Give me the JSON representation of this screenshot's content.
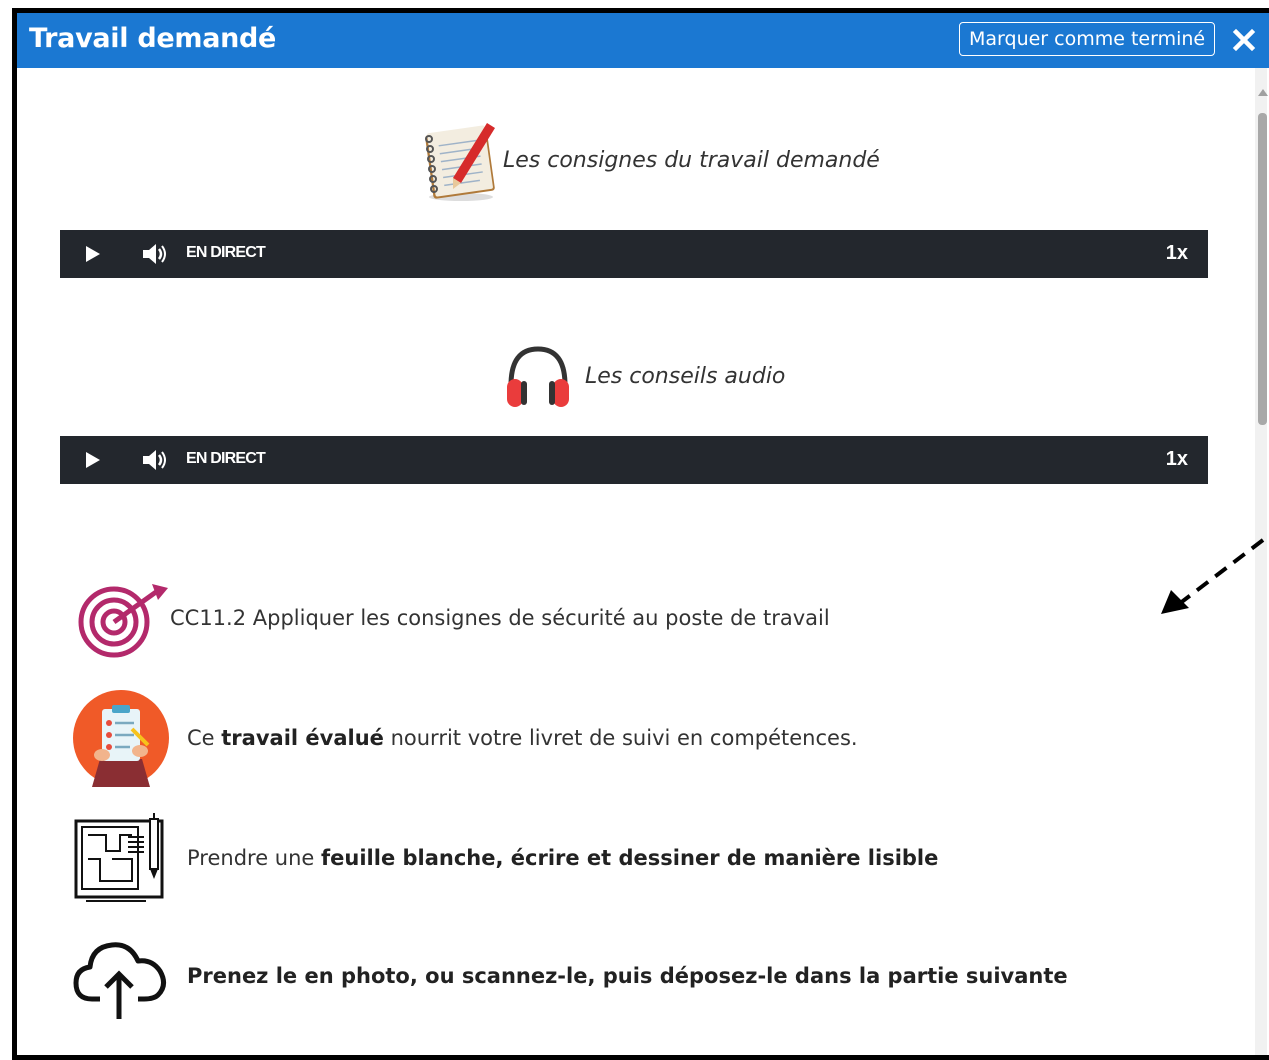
{
  "header": {
    "title": "Travail demandé",
    "mark_done_label": "Marquer comme terminé",
    "accent_color": "#1b78d2"
  },
  "sections": [
    {
      "icon": "notebook-pencil-icon",
      "label": "Les consignes du travail demandé",
      "player": {
        "status": "EN DIRECT",
        "speed": "1x"
      }
    },
    {
      "icon": "headphones-icon",
      "label": "Les conseils audio",
      "player": {
        "status": "EN DIRECT",
        "speed": "1x"
      }
    }
  ],
  "items": [
    {
      "icon": "target-icon",
      "text": "CC11.2 Appliquer les consignes de sécurité au poste de travail"
    },
    {
      "icon": "clipboard-checklist-icon",
      "pre": "Ce ",
      "bold": "travail évalué",
      "post": " nourrit votre livret de suivi en compétences."
    },
    {
      "icon": "blueprint-drawing-icon",
      "pre": "Prendre une ",
      "bold": "feuille blanche, écrire et dessiner de manière lisible"
    },
    {
      "icon": "cloud-upload-icon",
      "bold": "Prenez le en photo, ou scannez-le, puis déposez-le dans la partie suivante"
    }
  ]
}
